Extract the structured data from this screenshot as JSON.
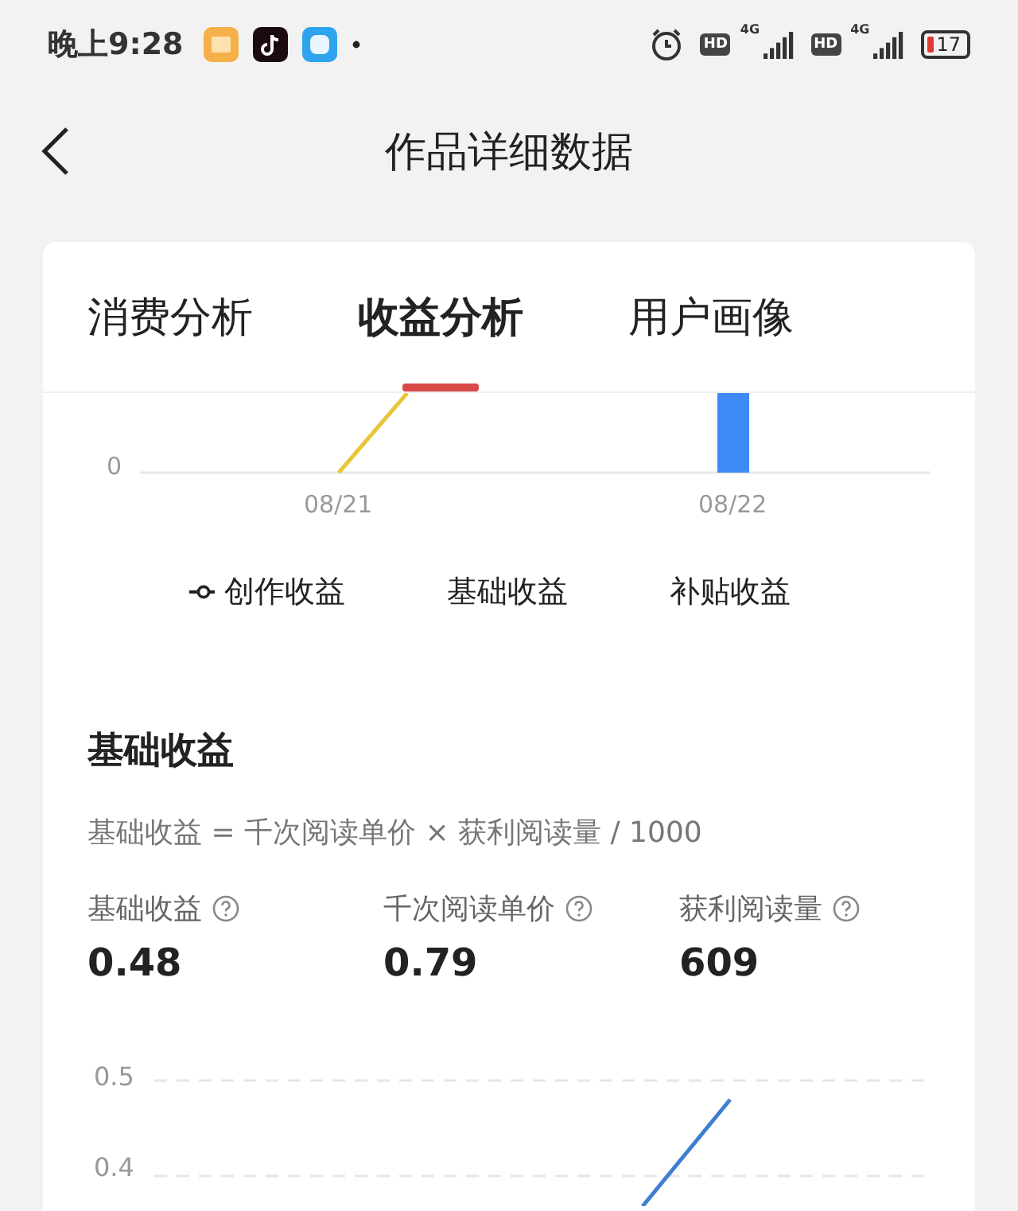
{
  "status_bar": {
    "time": "晚上9:28",
    "sim": [
      {
        "hd": "HD",
        "network": "4G"
      },
      {
        "hd": "HD",
        "network": "4G"
      }
    ],
    "battery": "17"
  },
  "header": {
    "title": "作品详细数据"
  },
  "tabs": [
    {
      "label": "消费分析",
      "selected": false
    },
    {
      "label": "收益分析",
      "selected": true
    },
    {
      "label": "用户画像",
      "selected": false
    }
  ],
  "top_chart": {
    "y_tick": "0",
    "x_labels": [
      "08/21",
      "08/22"
    ]
  },
  "legend": [
    {
      "label": "创作收益",
      "kind": "line"
    },
    {
      "label": "基础收益",
      "kind": "plain"
    },
    {
      "label": "补贴收益",
      "kind": "plain"
    }
  ],
  "section": {
    "title": "基础收益",
    "formula": "基础收益 = 千次阅读单价 × 获利阅读量 / 1000",
    "stats": [
      {
        "label": "基础收益",
        "value": "0.48"
      },
      {
        "label": "千次阅读单价",
        "value": "0.79"
      },
      {
        "label": "获利阅读量",
        "value": "609"
      }
    ]
  },
  "bottom_chart": {
    "y_ticks": [
      "0.5",
      "0.4"
    ]
  }
}
